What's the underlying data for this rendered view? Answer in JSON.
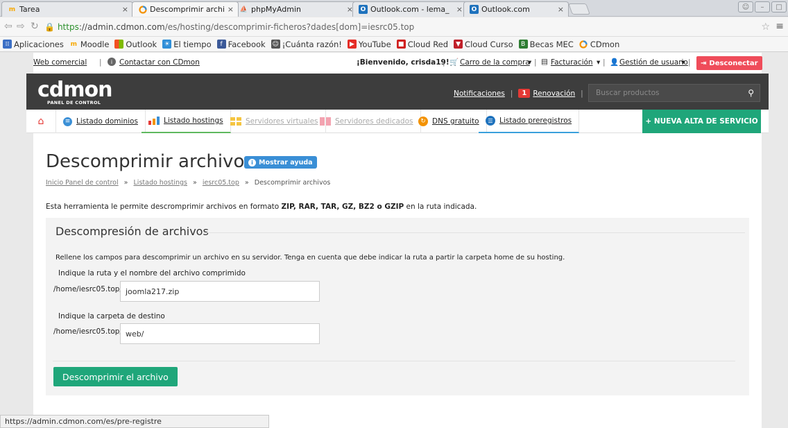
{
  "browser": {
    "tabs": [
      {
        "label": "Tarea",
        "icon": "moodle-icon"
      },
      {
        "label": "Descomprimir archiv",
        "icon": "cdmon-icon"
      },
      {
        "label": "phpMyAdmin",
        "icon": "phpmyadmin-icon"
      },
      {
        "label": "Outlook.com - lema_",
        "icon": "outlook-icon"
      },
      {
        "label": "Outlook.com",
        "icon": "outlook-icon"
      }
    ],
    "url_scheme": "https",
    "url_host": "://admin.cdmon.com",
    "url_path": "/es/hosting/descomprimir-ficheros?dades[dom]=iesrc05.top",
    "bookmarks": [
      {
        "label": "Aplicaciones",
        "icon": "apps-icon",
        "color": "#3b6fc5"
      },
      {
        "label": "Moodle",
        "icon": "moodle-icon",
        "color": "#f7a800"
      },
      {
        "label": "Outlook",
        "icon": "windows-icon",
        "color": "#f25022"
      },
      {
        "label": "El tiempo",
        "icon": "weather-icon",
        "color": "#2f8fd8"
      },
      {
        "label": "Facebook",
        "icon": "facebook-icon",
        "color": "#3b5998"
      },
      {
        "label": "¡Cuánta razón!",
        "icon": "meme-icon",
        "color": "#555555"
      },
      {
        "label": "YouTube",
        "icon": "youtube-icon",
        "color": "#e52d27"
      },
      {
        "label": "Cloud Red",
        "icon": "cloud-red-icon",
        "color": "#d0201f"
      },
      {
        "label": "Cloud Curso",
        "icon": "cloud-curso-icon",
        "color": "#c0202a"
      },
      {
        "label": "Becas MEC",
        "icon": "becas-icon",
        "color": "#2e7d32"
      },
      {
        "label": "CDmon",
        "icon": "cdmon-icon",
        "color": "#f39200"
      }
    ],
    "status_url": "https://admin.cdmon.com/es/pre-registre"
  },
  "toplinks": {
    "web_comercial": "Web comercial",
    "separator": "|",
    "contactar": "Contactar con CDmon",
    "welcome": "¡Bienvenido, crisda19!",
    "carro": "Carro de la compra",
    "facturacion": "Facturación",
    "gestion": "Gestión de usuario",
    "desconectar": "Desconectar"
  },
  "header": {
    "logo": "cdmon",
    "logo_sub": "PANEL DE CONTROL",
    "notificaciones": "Notificaciones",
    "badge": "1",
    "renovacion": "Renovación",
    "search_placeholder": "Buscar productos"
  },
  "nav": {
    "items": [
      {
        "label": "Listado dominios"
      },
      {
        "label": "Listado hostings"
      },
      {
        "label": "Servidores virtuales"
      },
      {
        "label": "Servidores dedicados"
      },
      {
        "label": "DNS gratuito"
      },
      {
        "label": "Listado preregistros"
      }
    ],
    "new_service": "+ NUEVA ALTA DE SERVICIO"
  },
  "content": {
    "title": "Descomprimir archivos",
    "help_button": "Mostrar ayuda",
    "breadcrumb": [
      "Inicio Panel de control",
      "Listado hostings",
      "iesrc05.top",
      "Descomprimir archivos"
    ],
    "breadcrumb_sep": "»",
    "intro_prefix": "Esta herramienta le permite descromprimir archivos en formato",
    "intro_formats": "ZIP, RAR, TAR, GZ, BZ2 o GZIP",
    "intro_suffix": "en la ruta indicada."
  },
  "panel": {
    "title": "Descompresión de archivos",
    "description": "Rellene los campos para descomprimir un archivo en su servidor. Tenga en cuenta que debe indicar la ruta a partir la carpeta home de su hosting.",
    "label_file": "Indique la ruta y el nombre del archivo comprimido",
    "prefix_file": "/home/iesrc05.top/",
    "value_file": "joomla217.zip",
    "label_dest": "Indique la carpeta de destino",
    "prefix_dest": "/home/iesrc05.top/",
    "value_dest": "web/",
    "submit": "Descomprimir el archivo"
  },
  "colors": {
    "accent_green": "#1fa67a",
    "header_dark": "#3d3d3d",
    "help_blue": "#3a8fd6",
    "disconnect_red": "#ef4c5a"
  }
}
